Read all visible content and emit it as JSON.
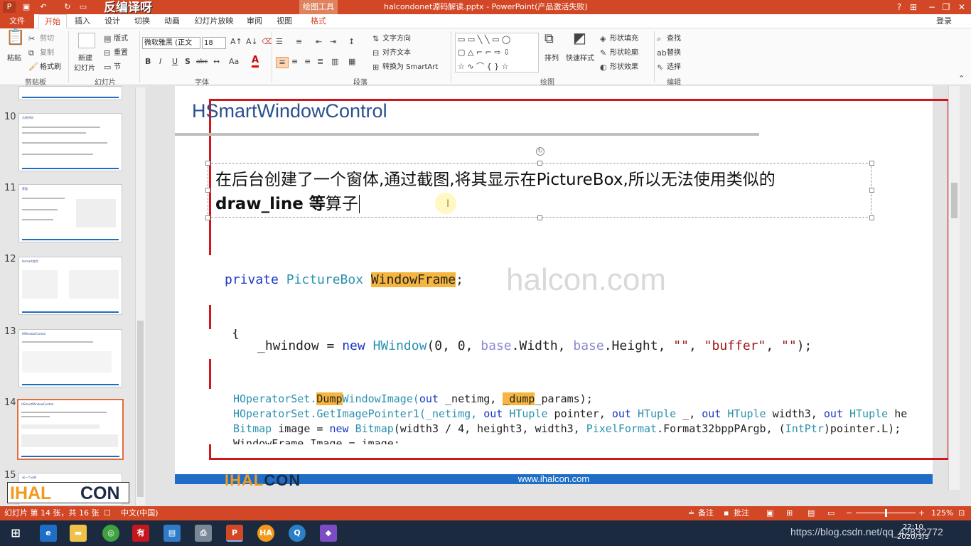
{
  "titlebar": {
    "watermark": "反编译呀",
    "context_tab": "绘图工具",
    "document_title": "halcondonet源码解读.pptx - PowerPoint(产品激活失败)",
    "help": "?",
    "restore_ribbon": "⊞",
    "minimize": "−",
    "maximize": "❐",
    "close": "✕"
  },
  "tabs": {
    "file": "文件",
    "home": "开始",
    "insert": "插入",
    "design": "设计",
    "transitions": "切换",
    "animations": "动画",
    "slideshow": "幻灯片放映",
    "review": "审阅",
    "view": "视图",
    "format": "格式",
    "login": "登录"
  },
  "ribbon": {
    "clipboard": {
      "paste": "粘贴",
      "cut": "剪切",
      "copy": "复制",
      "format_painter": "格式刷",
      "label": "剪贴板"
    },
    "slides": {
      "new_slide": "新建",
      "new_slide2": "幻灯片",
      "layout": "版式",
      "reset": "重置",
      "section": "节",
      "label": "幻灯片"
    },
    "font": {
      "family": "微软雅黑 (正文",
      "size": "18",
      "label": "字体",
      "bold": "B",
      "italic": "I",
      "underline": "U",
      "shadow": "S",
      "strike": "abc",
      "case": "Aa"
    },
    "paragraph": {
      "text_direction": "文字方向",
      "align_text": "对齐文本",
      "smartart": "转换为 SmartArt",
      "label": "段落"
    },
    "drawing": {
      "arrange": "排列",
      "quick_styles": "快速样式",
      "shape_fill": "形状填充",
      "shape_outline": "形状轮廓",
      "shape_effects": "形状效果",
      "label": "绘图"
    },
    "editing": {
      "find": "查找",
      "replace": "替换",
      "select": "选择",
      "label": "编辑"
    }
  },
  "slide_panel": {
    "slides": [
      {
        "num": "10",
        "title": "示例代码"
      },
      {
        "num": "11",
        "title": "界面"
      },
      {
        "num": "12",
        "title": "Hsmart控件"
      },
      {
        "num": "13",
        "title": "HWindowControl"
      },
      {
        "num": "14",
        "title": "HSmartWindowControl"
      },
      {
        "num": "15",
        "title": "另一个示例"
      }
    ]
  },
  "slide": {
    "title": "HSmartWindowControl",
    "body_line1": "在后台创建了一个窗体,通过截图,将其显示在PictureBox,所以无法使用类似的",
    "body_bold": "draw_line 等",
    "body_rest": "算子",
    "code1": {
      "kw": "private",
      "type": "PictureBox",
      "name": "WindowFrame",
      "end": ";"
    },
    "code2": {
      "brace": "{",
      "var": "_hwindow",
      "eq": " = ",
      "kw": "new",
      "type": "HWindow",
      "args1": "(0,  0, ",
      "base1": "base",
      "w": ".Width, ",
      "base2": "base",
      "h": ".Height, ",
      "s1": "\"\"",
      "comma1": ", ",
      "s2": "\"buffer\"",
      "comma2": ", ",
      "s3": "\"\"",
      "end": ");"
    },
    "code3": {
      "line1_a": "HOperatorSet.",
      "line1_hl": "Dump",
      "line1_b": "WindowImage(",
      "line1_out": "out",
      "line1_c": " _netimg, ",
      "line1_hl2": "_dump",
      "line1_d": "_params);",
      "line2_a": "HOperatorSet.",
      "line2_b": "GetImagePointer1(_netimg, ",
      "line2_out1": "out",
      "line2_t1": " HTuple",
      "line2_c": " pointer, ",
      "line2_out2": "out",
      "line2_t2": " HTuple",
      "line2_d": " _, ",
      "line2_out3": "out",
      "line2_t3": " HTuple",
      "line2_e": " width3, ",
      "line2_out4": "out",
      "line2_t4": " HTuple",
      "line2_f": " heigh",
      "line3_t": "Bitmap",
      "line3_a": " image = ",
      "line3_new": "new",
      "line3_t2": " Bitmap",
      "line3_b": "(width3 / 4, height3, width3, ",
      "line3_t3": "PixelFormat",
      "line3_c": ".Format32bppPArgb, (",
      "line3_t4": "IntPtr",
      "line3_d": ")pointer.L);",
      "line4": "WindowFrame.Image = image;"
    },
    "watermark": "halcon.com",
    "footer_url": "www.ihalcon.com",
    "footer_logo_a": "IHAL",
    "footer_logo_b": "CON"
  },
  "overlay_logo": {
    "a": "IHAL",
    "b": "CON"
  },
  "statusbar": {
    "slide_info": "幻灯片 第 14 张，共 16 张",
    "language": "中文(中国)",
    "notes": "备注",
    "comments": "批注",
    "zoom": "125%"
  },
  "taskbar": {
    "url": "https://blog.csdn.net/qq_42832772",
    "time": "22:10",
    "date": "2020/3/3"
  }
}
